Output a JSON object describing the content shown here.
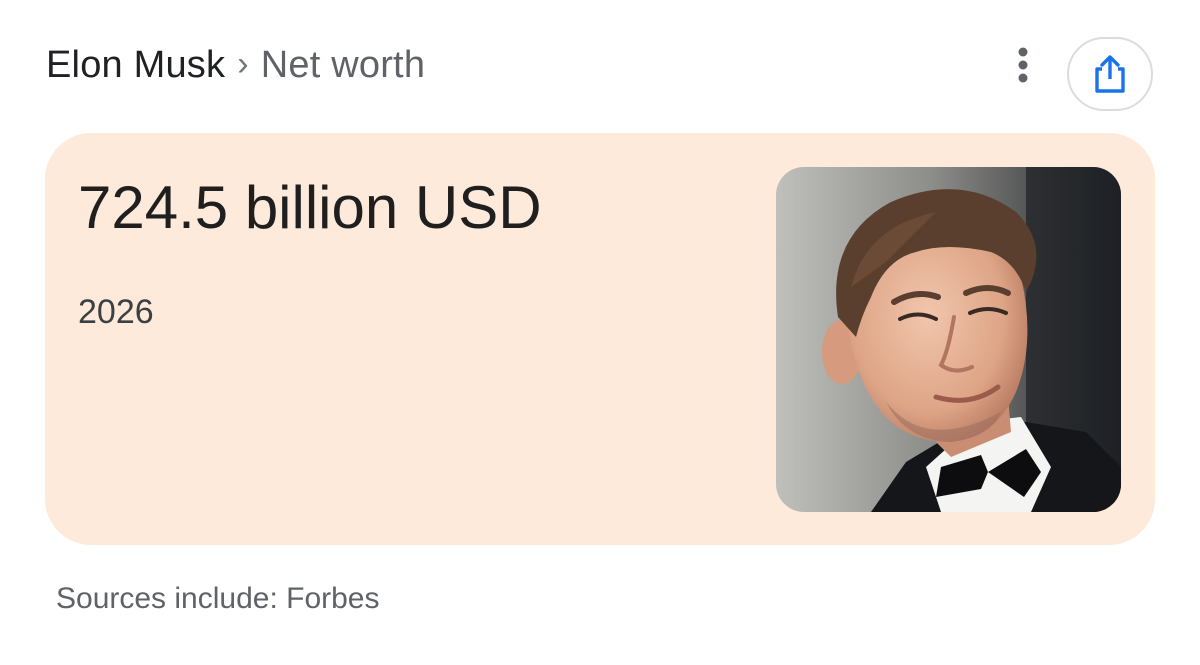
{
  "header": {
    "breadcrumb_root": "Elon Musk",
    "separator": "›",
    "breadcrumb_current": "Net worth",
    "more_icon": "more-vert-icon",
    "share_icon": "share-icon"
  },
  "card": {
    "amount": "724.5 billion USD",
    "year": "2026",
    "image_alt": "Elon Musk"
  },
  "footer": {
    "sources": "Sources include: Forbes"
  },
  "colors": {
    "card_background": "#fdeada",
    "share_icon": "#1a73e8",
    "primary_text": "#202124",
    "secondary_text": "#5f6368"
  }
}
